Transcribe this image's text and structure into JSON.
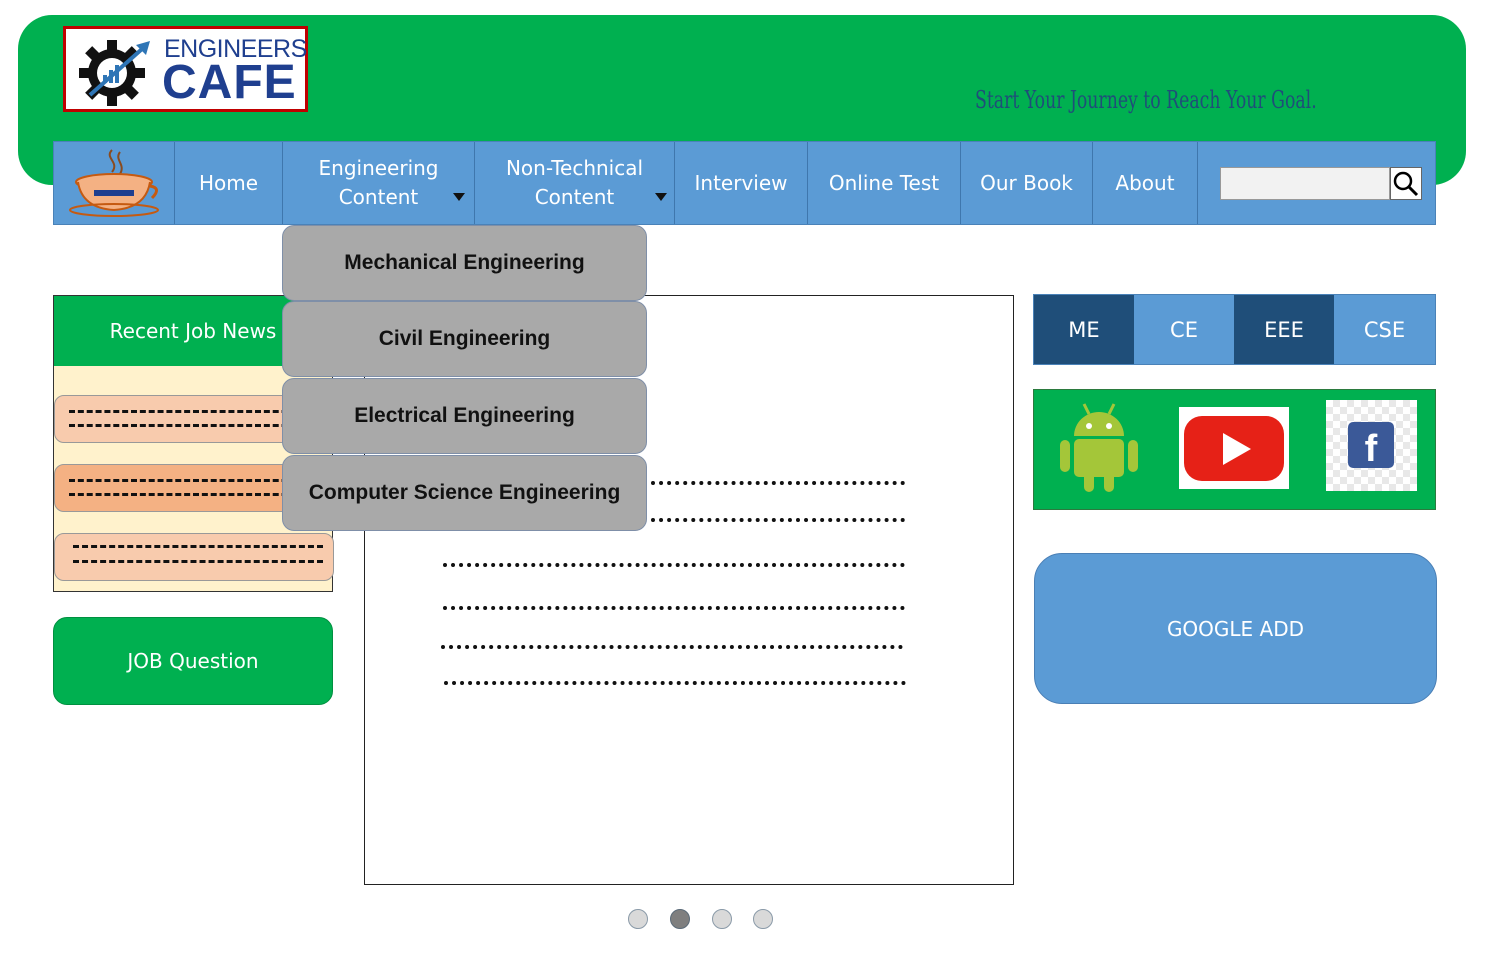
{
  "header": {
    "logo_line1": "ENGINEERS",
    "logo_line2": "CAFE",
    "tagline": "Start Your Journey to Reach Your Goal."
  },
  "nav": {
    "items": [
      {
        "label": "Home"
      },
      {
        "label": "Engineering Content"
      },
      {
        "label": "Non-Technical Content"
      },
      {
        "label": "Interview"
      },
      {
        "label": "Online Test"
      },
      {
        "label": "Our Book"
      },
      {
        "label": "About"
      }
    ],
    "search_placeholder": ""
  },
  "dropdown": {
    "items": [
      {
        "label": "Mechanical Engineering"
      },
      {
        "label": "Civil Engineering"
      },
      {
        "label": "Electrical Engineering"
      },
      {
        "label": "Computer Science Engineering"
      }
    ]
  },
  "left": {
    "news_title": "Recent Job News",
    "job_question": "JOB Question"
  },
  "carousel": {
    "slide_count": 4,
    "active_index": 2
  },
  "right": {
    "tabs": [
      {
        "label": "ME"
      },
      {
        "label": "CE"
      },
      {
        "label": "EEE"
      },
      {
        "label": "CSE"
      }
    ],
    "social_icons": [
      "android-icon",
      "youtube-icon",
      "facebook-icon"
    ],
    "google_add": "GOOGLE ADD"
  },
  "colors": {
    "green": "#00b050",
    "blue": "#5b9bd5",
    "dark_blue": "#1f4e79",
    "dropdown_gray": "#a9a9a9",
    "news_bg": "#fff2cc"
  }
}
